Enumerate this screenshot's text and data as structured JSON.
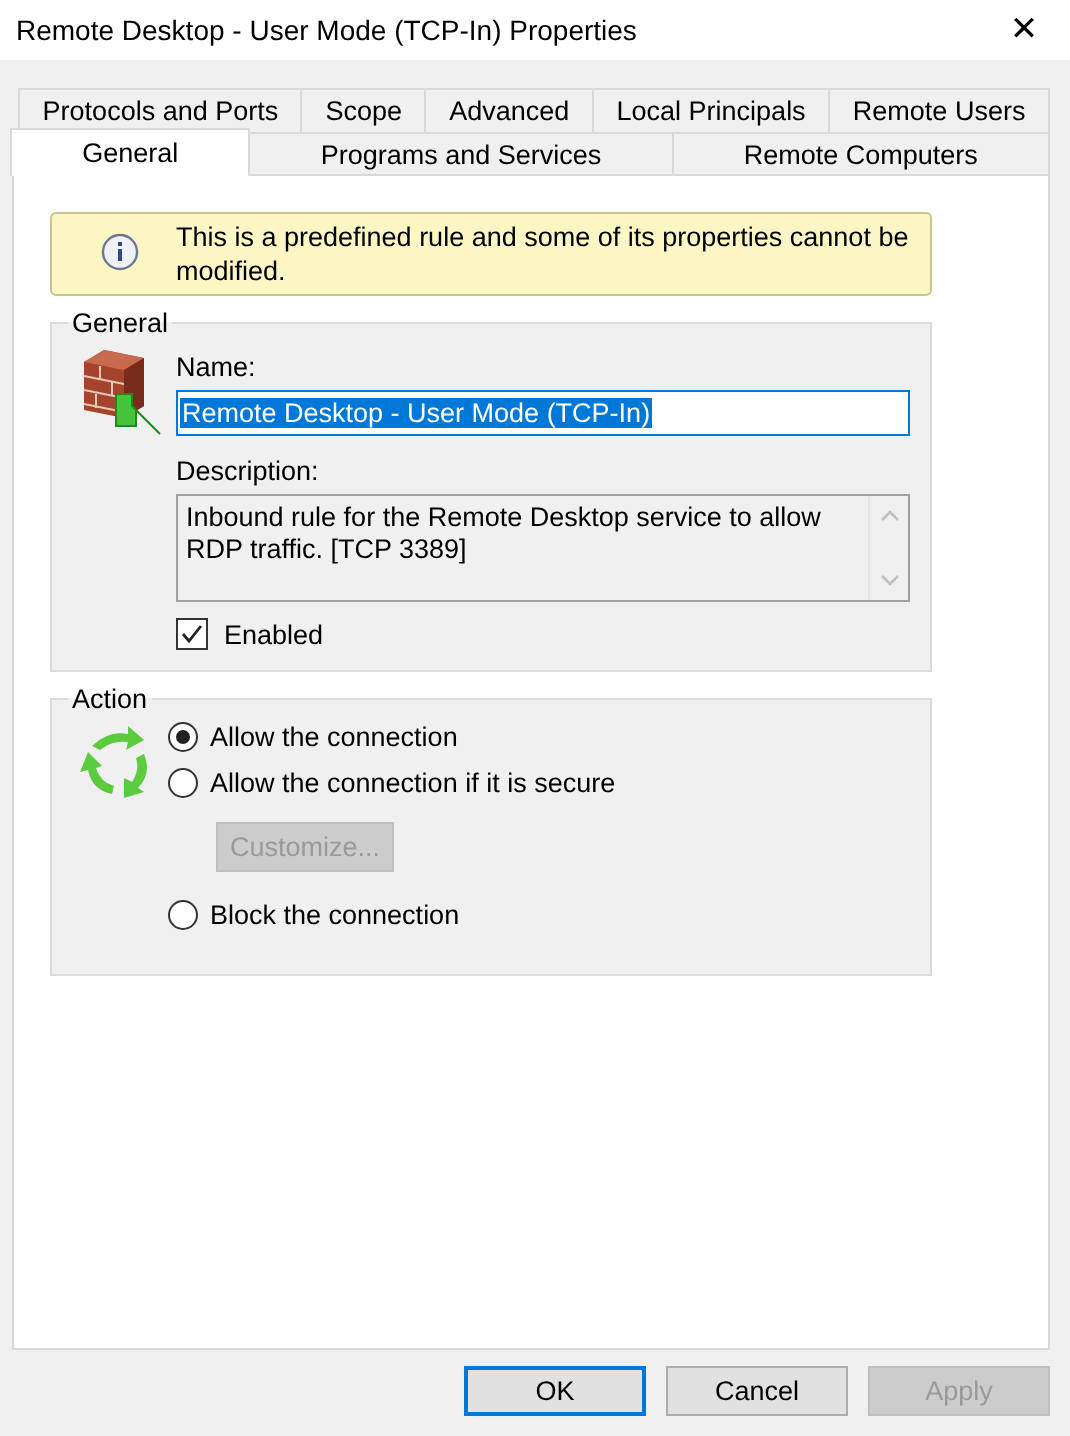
{
  "window": {
    "title": "Remote Desktop - User Mode (TCP-In) Properties",
    "close": "✕"
  },
  "tab_rows": [
    {
      "tabs": [
        {
          "label": "Protocols and Ports",
          "selected": false
        },
        {
          "label": "Scope",
          "selected": false
        },
        {
          "label": "Advanced",
          "selected": false
        },
        {
          "label": "Local Principals",
          "selected": false
        },
        {
          "label": "Remote Users",
          "selected": false
        }
      ]
    },
    {
      "tabs": [
        {
          "label": "General",
          "selected": true
        },
        {
          "label": "Programs and Services",
          "selected": false
        },
        {
          "label": "Remote Computers",
          "selected": false
        }
      ]
    }
  ],
  "info_banner": {
    "text": "This is a predefined rule and some of its properties cannot be modified."
  },
  "general": {
    "legend": "General",
    "name_label": "Name:",
    "name_value": "Remote Desktop - User Mode (TCP-In)",
    "description_label": "Description:",
    "description": "Inbound rule for the Remote Desktop service to allow RDP traffic. [TCP 3389]",
    "enabled": {
      "label": "Enabled",
      "checked": true
    }
  },
  "action": {
    "legend": "Action",
    "options": [
      {
        "kind": "radio",
        "label": "Allow the connection",
        "selected": true
      },
      {
        "kind": "radio",
        "label": "Allow the connection if it is secure",
        "selected": false
      },
      {
        "kind": "button",
        "label": "Customize...",
        "disabled": true
      },
      {
        "kind": "radio",
        "label": "Block the connection",
        "selected": false
      }
    ]
  },
  "buttons": [
    {
      "label": "OK",
      "default": true,
      "disabled": false
    },
    {
      "label": "Cancel",
      "default": false,
      "disabled": false
    },
    {
      "label": "Apply",
      "default": false,
      "disabled": true
    }
  ]
}
